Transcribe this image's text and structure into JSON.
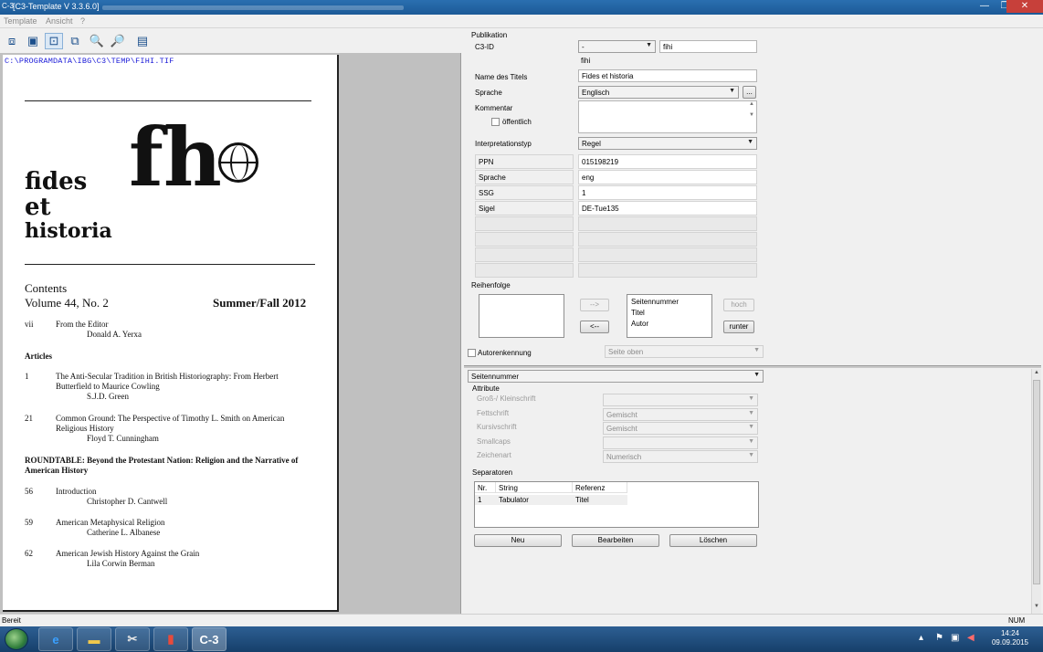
{
  "window": {
    "app_icon_text": "C-3",
    "title": "[C3-Template V 3.3.6.0]",
    "controls": [
      "—",
      "❐",
      "✕"
    ]
  },
  "menu": [
    "Template",
    "Ansicht",
    "?"
  ],
  "toolbar_icons": [
    "fit-page-icon",
    "fit-width-icon",
    "actual-size-icon",
    "fit-height-icon",
    "zoom-in-icon",
    "zoom-out-icon",
    "color-mode-icon"
  ],
  "viewer": {
    "file_path": "C:\\PROGRAMDATA\\IBG\\C3\\TEMP\\FIHI.TIF",
    "logo": {
      "line1": "fides",
      "line2": "et",
      "line3": "historia",
      "mark": "fh"
    },
    "contents_heading": "Contents",
    "volume": "Volume 44, No. 2",
    "season": "Summer/Fall 2012",
    "entries": [
      {
        "num": "vii",
        "title": "From the Editor",
        "author": "Donald A. Yerxa"
      },
      {
        "num": "",
        "title": "Articles",
        "author": ""
      },
      {
        "num": "1",
        "title": "The Anti-Secular Tradition in British Historiography: From Herbert",
        "title2": "Butterfield to Maurice Cowling",
        "author": "S.J.D. Green"
      },
      {
        "num": "21",
        "title": "Common Ground: The Perspective of Timothy L. Smith on American",
        "title2": "Religious History",
        "author": "Floyd T. Cunningham"
      },
      {
        "num": "",
        "title": "ROUNDTABLE: Beyond the Protestant Nation: Religion and the Narrative of",
        "title2": "American History",
        "author": ""
      },
      {
        "num": "56",
        "title": "Introduction",
        "author": "Christopher D. Cantwell"
      },
      {
        "num": "59",
        "title": "American Metaphysical Religion",
        "author": "Catherine L. Albanese"
      },
      {
        "num": "62",
        "title": "American Jewish History Against the Grain",
        "author": "Lila Corwin Berman"
      }
    ]
  },
  "publikation": {
    "group_label": "Publikation",
    "c3id_label": "C3-ID",
    "c3id_select": "-",
    "c3id_value": "fihi",
    "c3id_sub": "fihi",
    "name_label": "Name des Titels",
    "name_value": "Fides et historia",
    "sprache_label": "Sprache",
    "sprache_value": "Englisch",
    "ellipsis": "...",
    "kommentar_label": "Kommentar",
    "oeffentlich_label": "öffentlich",
    "interp_label": "Interpretationstyp",
    "interp_value": "Regel",
    "meta_rows": [
      {
        "key": "PPN",
        "value": "015198219"
      },
      {
        "key": "Sprache",
        "value": "eng"
      },
      {
        "key": "SSG",
        "value": "1"
      },
      {
        "key": "Sigel",
        "value": "DE-Tue135"
      }
    ]
  },
  "reihenfolge": {
    "label": "Reihenfolge",
    "btn_right": "-->",
    "btn_left": "<--",
    "items": [
      "Seitennummer",
      "Titel",
      "Autor"
    ],
    "btn_hoch": "hoch",
    "btn_runter": "runter",
    "autorenkennung_label": "Autorenkennung",
    "seite_select": "Seite oben"
  },
  "bottom": {
    "element_select": "Seitennummer",
    "attribute_label": "Attribute",
    "attributes": [
      {
        "label": "Groß-/ Kleinschrift",
        "value": ""
      },
      {
        "label": "Fettschrift",
        "value": "Gemischt"
      },
      {
        "label": "Kursivschrift",
        "value": "Gemischt"
      },
      {
        "label": "Smallcaps",
        "value": ""
      },
      {
        "label": "Zeichenart",
        "value": "Numerisch"
      }
    ],
    "separatoren_label": "Separatoren",
    "sep_headers": [
      "Nr.",
      "String",
      "Referenz"
    ],
    "sep_rows": [
      {
        "nr": "1",
        "string": "Tabulator",
        "referenz": "Titel"
      }
    ],
    "btn_neu": "Neu",
    "btn_bearbeiten": "Bearbeiten",
    "btn_loeschen": "Löschen"
  },
  "status": {
    "left": "Bereit",
    "right": "NUM"
  },
  "taskbar": {
    "c3_label": "C-3",
    "time": "14:24",
    "date": "09.09.2015"
  }
}
